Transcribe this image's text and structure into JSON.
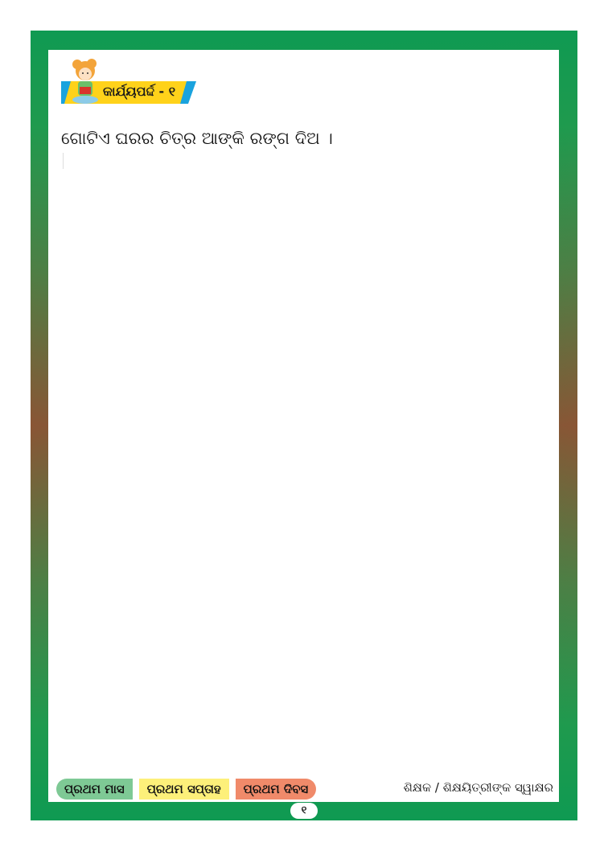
{
  "header": {
    "badge_label": "କାର୍ଯ୍ୟପର୍ଦ୍ଦ - ୧",
    "badge_color": "#ffd21a",
    "badge_accent": "#1aa3de"
  },
  "main": {
    "instruction": "ଗୋଟିଏ ଘରର ଚିତ୍ର ଆଙ୍କି ରଙ୍ଗ ଦିଅ ।"
  },
  "footer": {
    "tags": [
      {
        "label": "ପ୍ରଥମ ମାସ",
        "color": "#7ec995"
      },
      {
        "label": "ପ୍ରଥମ ସପ୍ତାହ",
        "color": "#fdf07a"
      },
      {
        "label": "ପ୍ରଥମ ଦିବସ",
        "color": "#f08a6a"
      }
    ],
    "signature_label": "ଶିକ୍ଷକ / ଶିକ୍ଷୟିତ୍ରୀଙ୍କ ସ୍ୱାକ୍ଷର",
    "page_number": "୧"
  },
  "frame": {
    "border_color": "#1f9a4e"
  }
}
